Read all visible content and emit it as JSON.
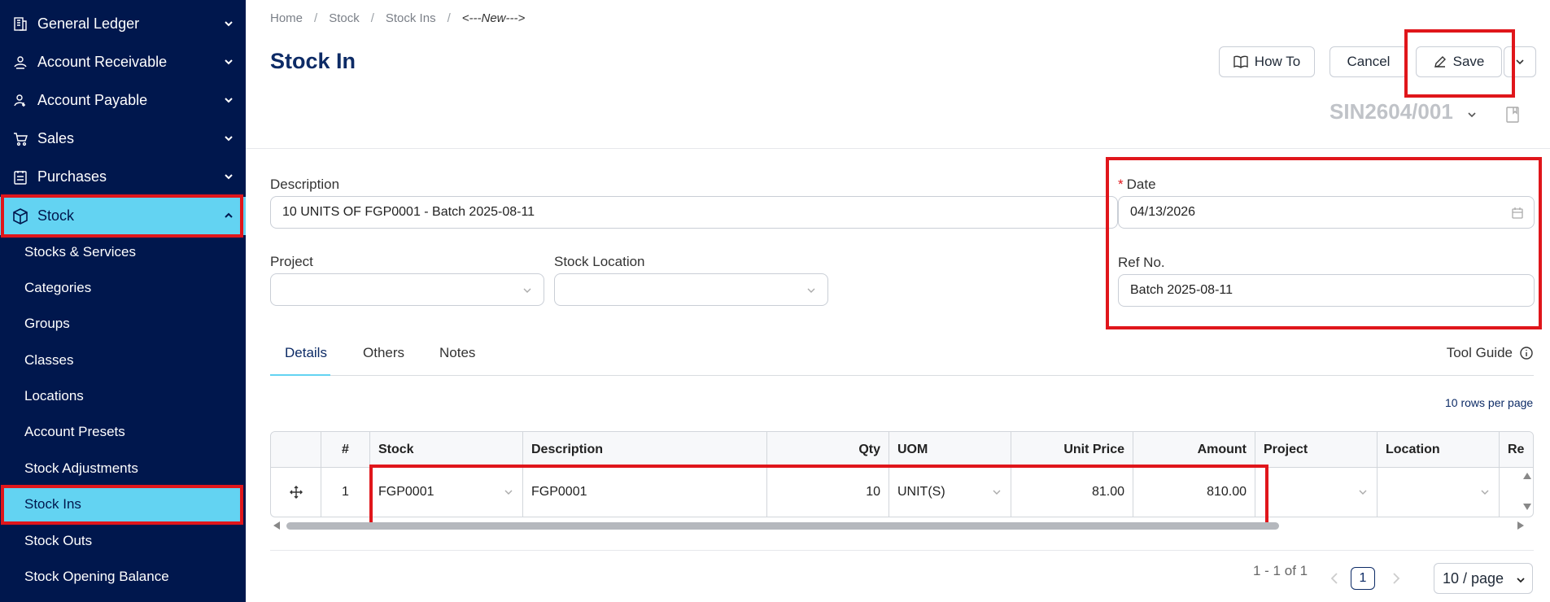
{
  "sidebar": {
    "groups": [
      {
        "label": "General Ledger",
        "icon": "ledger-icon"
      },
      {
        "label": "Account Receivable",
        "icon": "receivable-icon"
      },
      {
        "label": "Account Payable",
        "icon": "payable-icon"
      },
      {
        "label": "Sales",
        "icon": "cart-icon"
      },
      {
        "label": "Purchases",
        "icon": "purchases-icon"
      },
      {
        "label": "Stock",
        "icon": "cube-icon"
      }
    ],
    "stock_items": [
      "Stocks & Services",
      "Categories",
      "Groups",
      "Classes",
      "Locations",
      "Account Presets",
      "Stock Adjustments",
      "Stock Ins",
      "Stock Outs",
      "Stock Opening Balance"
    ]
  },
  "breadcrumb": [
    "Home",
    "Stock",
    "Stock Ins",
    "<---New--->"
  ],
  "page": {
    "title": "Stock In",
    "doc_number": "SIN2604/001"
  },
  "toolbar": {
    "howto_label": "How To",
    "cancel_label": "Cancel",
    "save_label": "Save"
  },
  "form": {
    "description_label": "Description",
    "description_value": "10 UNITS OF FGP0001 - Batch 2025-08-11",
    "date_label": "Date",
    "date_value": "04/13/2026",
    "project_label": "Project",
    "project_value": "",
    "location_label": "Stock Location",
    "location_value": "",
    "refno_label": "Ref No.",
    "refno_value": "Batch 2025-08-11"
  },
  "tabs": [
    "Details",
    "Others",
    "Notes"
  ],
  "tool_guide_label": "Tool Guide",
  "rows_per_page_note": "10 rows per page",
  "grid": {
    "columns": [
      "#",
      "Stock",
      "Description",
      "Qty",
      "UOM",
      "Unit Price",
      "Amount",
      "Project",
      "Location",
      "Re"
    ],
    "rows": [
      {
        "no": "1",
        "stock": "FGP0001",
        "description": "FGP0001",
        "qty": "10",
        "uom": "UNIT(S)",
        "unit_price": "81.00",
        "amount": "810.00",
        "project": "",
        "location": ""
      }
    ]
  },
  "pagination": {
    "range": "1 - 1 of 1",
    "current_page": "1",
    "page_size": "10 / page"
  },
  "colors": {
    "sidebar_bg": "#00174d",
    "active_bg": "#63d3f2",
    "title": "#0d2b66",
    "highlight": "#e0161b"
  }
}
